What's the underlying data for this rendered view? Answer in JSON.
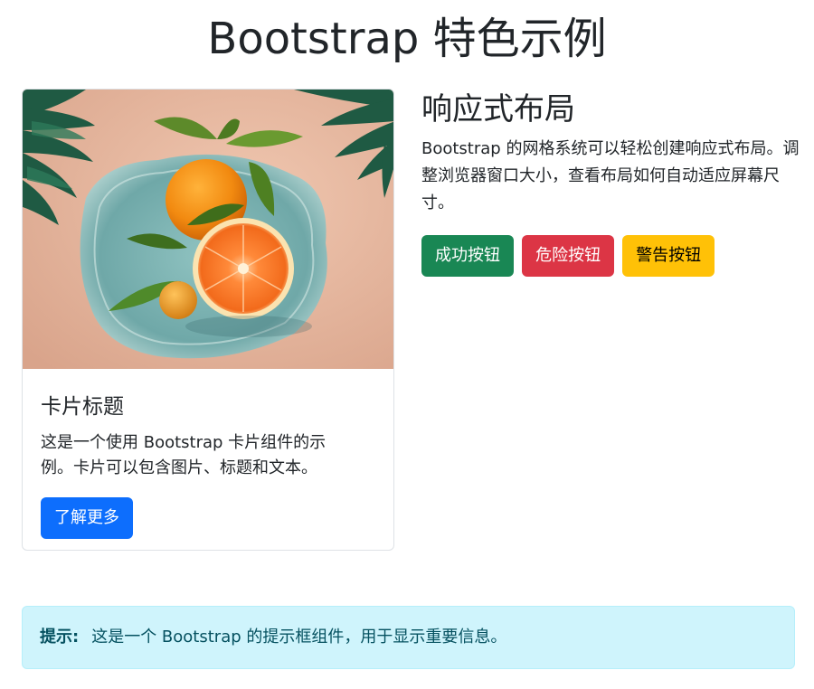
{
  "page": {
    "title": "Bootstrap 特色示例"
  },
  "card": {
    "image_alt": "柑橘静物图片",
    "title": "卡片标题",
    "text": "这是一个使用 Bootstrap 卡片组件的示例。卡片可以包含图片、标题和文本。",
    "button_label": "了解更多"
  },
  "responsive": {
    "title": "响应式布局",
    "text": "Bootstrap 的网格系统可以轻松创建响应式布局。调整浏览器窗口大小，查看布局如何自动适应屏幕尺寸。",
    "buttons": {
      "success": "成功按钮",
      "danger": "危险按钮",
      "warning": "警告按钮"
    }
  },
  "alert": {
    "label": "提示:",
    "text": "这是一个 Bootstrap 的提示框组件，用于显示重要信息。"
  },
  "colors": {
    "primary": "#0d6efd",
    "success": "#198754",
    "danger": "#dc3545",
    "warning": "#ffc107",
    "info_bg": "#cff4fc",
    "info_text": "#055160"
  }
}
